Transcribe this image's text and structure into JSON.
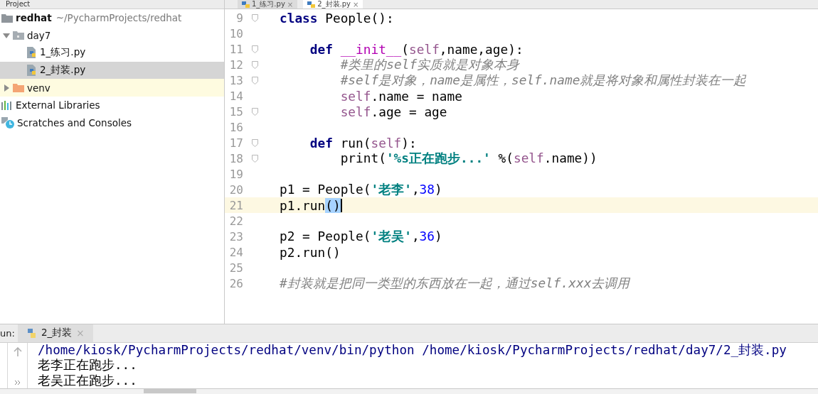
{
  "project_panel": {
    "title": "Project",
    "tree": [
      {
        "name": "redhat",
        "path": "~/PycharmProjects/redhat",
        "kind": "root",
        "selected": false,
        "children": [
          {
            "name": "day7",
            "kind": "folder",
            "selected": false,
            "expanded": true,
            "children": [
              {
                "name": "1_练习.py",
                "kind": "python-file",
                "selected": false
              },
              {
                "name": "2_封装.py",
                "kind": "python-file",
                "selected": true
              }
            ]
          },
          {
            "name": "venv",
            "kind": "excluded-folder",
            "selected": false,
            "expanded": false
          }
        ]
      },
      {
        "name": "External Libraries",
        "kind": "libraries",
        "selected": false
      },
      {
        "name": "Scratches and Consoles",
        "kind": "scratches",
        "selected": false
      }
    ]
  },
  "editor": {
    "tabs": [
      {
        "label": "1_练习.py",
        "selected": false,
        "close": "×"
      },
      {
        "label": "2_封装.py",
        "selected": true,
        "close": "×"
      }
    ],
    "lines": [
      {
        "number": "9",
        "fold": true,
        "current": false,
        "tokens": [
          {
            "kind": "keyword",
            "text": "class"
          },
          {
            "kind": "plain",
            "text": " People():"
          }
        ],
        "children": [
          {
            "number": "10",
            "fold": false,
            "current": false
          },
          {
            "number": "11",
            "fold": true,
            "current": false,
            "tokens": [
              {
                "kind": "keyword",
                "text": "def"
              },
              {
                "kind": "magic",
                "text": " __init__"
              },
              {
                "kind": "plain",
                "text": "("
              },
              {
                "kind": "self",
                "text": "self"
              },
              {
                "kind": "plain",
                "text": ",name,age):"
              }
            ],
            "children": [
              {
                "number": "12",
                "fold": true,
                "current": false,
                "tokens": [
                  {
                    "kind": "comment",
                    "text": "#类里的self实质就是对象本身"
                  }
                ]
              },
              {
                "number": "13",
                "fold": true,
                "current": false,
                "tokens": [
                  {
                    "kind": "comment",
                    "text": "#self是对象，name是属性，self.name就是将对象和属性封装在一起"
                  }
                ]
              },
              {
                "number": "14",
                "fold": false,
                "current": false,
                "tokens": [
                  {
                    "kind": "self",
                    "text": "self"
                  },
                  {
                    "kind": "plain",
                    "text": ".name = name"
                  }
                ]
              },
              {
                "number": "15",
                "fold": true,
                "current": false,
                "tokens": [
                  {
                    "kind": "self",
                    "text": "self"
                  },
                  {
                    "kind": "plain",
                    "text": ".age = age"
                  }
                ]
              }
            ]
          },
          {
            "number": "16",
            "fold": false,
            "current": false
          },
          {
            "number": "17",
            "fold": true,
            "current": false,
            "tokens": [
              {
                "kind": "keyword",
                "text": "def"
              },
              {
                "kind": "plain",
                "text": " run("
              },
              {
                "kind": "self",
                "text": "self"
              },
              {
                "kind": "plain",
                "text": "):"
              }
            ],
            "children": [
              {
                "number": "18",
                "fold": true,
                "current": false,
                "tokens": [
                  {
                    "kind": "plain",
                    "text": "print("
                  },
                  {
                    "kind": "string",
                    "text": "'%s正在跑步...'"
                  },
                  {
                    "kind": "plain",
                    "text": " %("
                  },
                  {
                    "kind": "self",
                    "text": "self"
                  },
                  {
                    "kind": "plain",
                    "text": ".name))"
                  }
                ]
              }
            ]
          }
        ]
      },
      {
        "number": "19",
        "fold": false,
        "current": false
      },
      {
        "number": "20",
        "fold": false,
        "current": false,
        "tokens": [
          {
            "kind": "plain",
            "text": "p1 = People("
          },
          {
            "kind": "string",
            "text": "'老李'"
          },
          {
            "kind": "plain",
            "text": ","
          },
          {
            "kind": "number",
            "text": "38"
          },
          {
            "kind": "plain",
            "text": ")"
          }
        ]
      },
      {
        "number": "21",
        "fold": false,
        "current": true,
        "tokens": [
          {
            "kind": "plain",
            "text": "p1.run"
          },
          {
            "kind": "selection",
            "text": "()"
          }
        ]
      },
      {
        "number": "22",
        "fold": false,
        "current": false
      },
      {
        "number": "23",
        "fold": false,
        "current": false,
        "tokens": [
          {
            "kind": "plain",
            "text": "p2 = People("
          },
          {
            "kind": "string",
            "text": "'老吴'"
          },
          {
            "kind": "plain",
            "text": ","
          },
          {
            "kind": "number",
            "text": "36"
          },
          {
            "kind": "plain",
            "text": ")"
          }
        ]
      },
      {
        "number": "24",
        "fold": false,
        "current": false,
        "tokens": [
          {
            "kind": "plain",
            "text": "p2.run()"
          }
        ]
      },
      {
        "number": "25",
        "fold": false,
        "current": false
      },
      {
        "number": "26",
        "fold": false,
        "current": false,
        "tokens": [
          {
            "kind": "comment",
            "text": "#封装就是把同一类型的东西放在一起，通过self.xxx去调用"
          }
        ]
      }
    ]
  },
  "run_panel": {
    "label": "un:",
    "tabs": [
      {
        "label": "2_封装",
        "selected": true,
        "close": "×"
      }
    ],
    "console": [
      {
        "kind": "command",
        "text": "/home/kiosk/PycharmProjects/redhat/venv/bin/python /home/kiosk/PycharmProjects/redhat/day7/2_封装.py"
      },
      {
        "kind": "output",
        "text": "老李正在跑步..."
      },
      {
        "kind": "output",
        "text": "老吴正在跑步..."
      }
    ]
  }
}
